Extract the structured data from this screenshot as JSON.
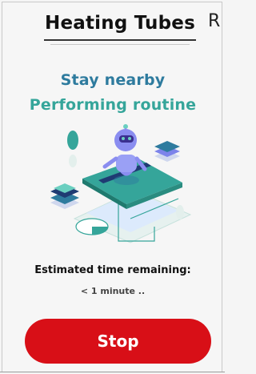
{
  "header": {
    "title": "Heating Tubes",
    "corner_glyph": "R"
  },
  "status": {
    "line1": "Stay nearby",
    "line2": "Performing routine"
  },
  "illustration": {
    "icon": "robot-illustration-icon"
  },
  "estimate": {
    "label": "Estimated time remaining:",
    "value": "< 1 minute .."
  },
  "actions": {
    "stop_label": "Stop"
  },
  "colors": {
    "title": "#111111",
    "status_line1": "#2e7b9e",
    "status_line2": "#35a59a",
    "stop_button": "#d80f17",
    "robot": "#8a8df0",
    "accent_green": "#35a59a"
  }
}
